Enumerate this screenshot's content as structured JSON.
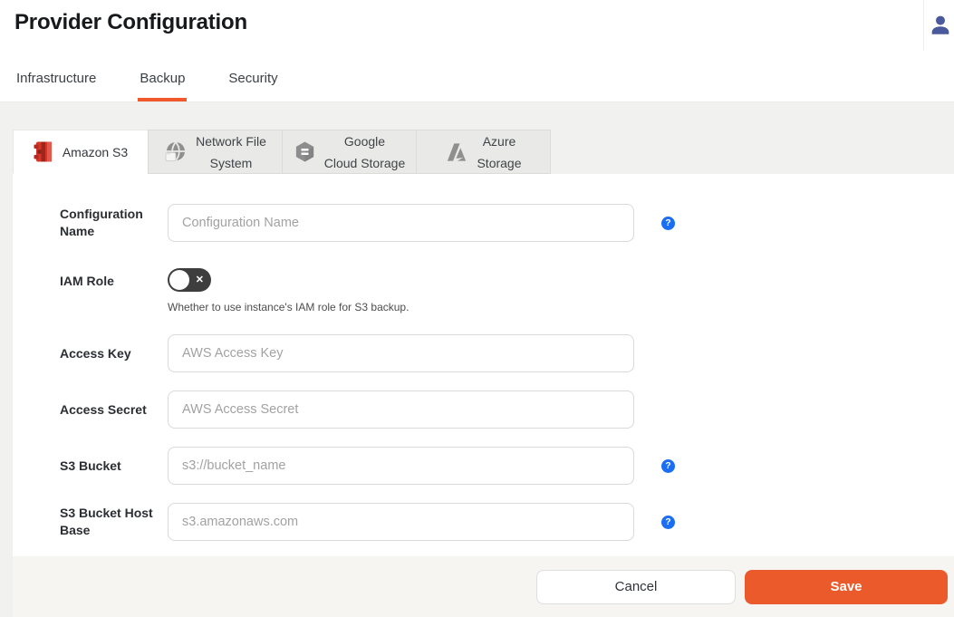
{
  "header": {
    "title": "Provider Configuration",
    "tabs": [
      {
        "label": "Infrastructure",
        "active": false
      },
      {
        "label": "Backup",
        "active": true
      },
      {
        "label": "Security",
        "active": false
      }
    ],
    "user_icon": "user-icon"
  },
  "provider_tabs": [
    {
      "label": "Amazon S3",
      "icon": "amazon-s3-icon",
      "active": true
    },
    {
      "label": "Network File\nSystem",
      "icon": "network-file-system-icon",
      "active": false
    },
    {
      "label": "Google\nCloud Storage",
      "icon": "google-cloud-storage-icon",
      "active": false
    },
    {
      "label": "Azure\nStorage",
      "icon": "azure-storage-icon",
      "active": false
    }
  ],
  "form": {
    "fields": [
      {
        "label": "Configuration Name",
        "placeholder": "Configuration Name",
        "value": "",
        "help": true
      },
      {
        "label": "IAM Role",
        "type": "toggle",
        "state": "off",
        "help_text": "Whether to use instance's IAM role for S3 backup."
      },
      {
        "label": "Access Key",
        "placeholder": "AWS Access Key",
        "value": "",
        "help": false
      },
      {
        "label": "Access Secret",
        "placeholder": "AWS Access Secret",
        "value": "",
        "help": false
      },
      {
        "label": "S3 Bucket",
        "placeholder": "s3://bucket_name",
        "value": "",
        "help": true
      },
      {
        "label": "S3 Bucket Host Base",
        "placeholder": "s3.amazonaws.com",
        "value": "",
        "help": true
      }
    ]
  },
  "footer": {
    "cancel_label": "Cancel",
    "save_label": "Save"
  },
  "icons": {
    "help_glyph": "?",
    "toggle_off_glyph": "✕"
  },
  "colors": {
    "accent_orange": "#eb5a2b",
    "tab_underline_orange": "#f1582b",
    "help_blue": "#1b6ef3",
    "toggle_off_bg": "#3e3e3e",
    "content_bg": "#f1f1ef",
    "footer_bg": "#f6f5f2",
    "inactive_tab_bg": "#e9e9e7",
    "user_icon_blue": "#4a589c",
    "s3_logo_red": "#d8342a"
  }
}
